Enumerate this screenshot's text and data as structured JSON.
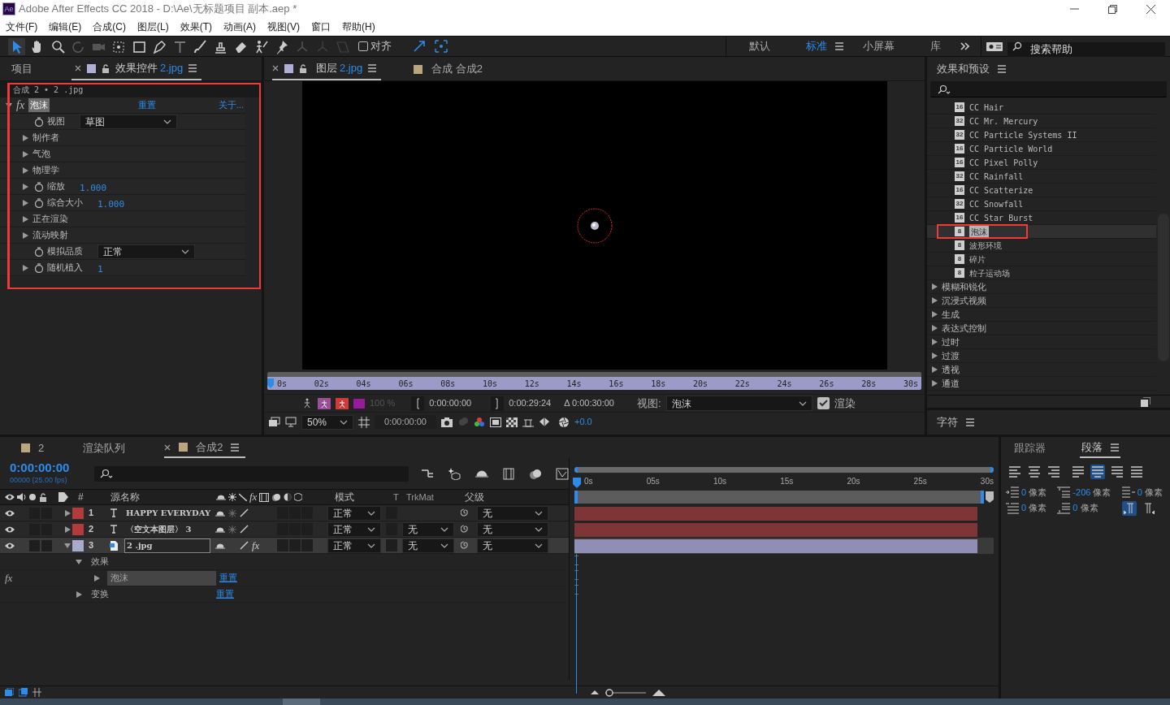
{
  "title_bar": {
    "app_icon": "Ae",
    "title": "Adobe After Effects CC 2018 - D:\\Ae\\无标题项目 副本.aep *"
  },
  "menu": [
    "文件(F)",
    "编辑(E)",
    "合成(C)",
    "图层(L)",
    "效果(T)",
    "动画(A)",
    "视图(V)",
    "窗口",
    "帮助(H)"
  ],
  "toolbar": {
    "snap": {
      "label": "对齐",
      "checked": false
    },
    "workspaces": [
      {
        "label": "默认",
        "selected": false
      },
      {
        "label": "标准",
        "selected": true
      },
      {
        "label": "小屏幕",
        "selected": false
      },
      {
        "label": "库",
        "selected": false
      }
    ],
    "search": {
      "placeholder": "搜索帮助"
    }
  },
  "effect_controls": {
    "tabs": [
      {
        "label": "项目",
        "selected": false
      },
      {
        "label": "效果控件",
        "suffix": "2.jpg",
        "selected": true
      }
    ],
    "breadcrumb": "合成 2 • 2 .jpg",
    "effect": {
      "fx": "fx",
      "name": "泡沫",
      "reset": "重置",
      "about": "关于..."
    },
    "properties": [
      {
        "label": "视图",
        "kind": "dropdown",
        "twirl": false,
        "stopwatch": true,
        "value": "草图"
      },
      {
        "label": "制作者",
        "kind": "group",
        "twirl": true,
        "stopwatch": false
      },
      {
        "label": "气泡",
        "kind": "group",
        "twirl": true,
        "stopwatch": false
      },
      {
        "label": "物理学",
        "kind": "group",
        "twirl": true,
        "stopwatch": false
      },
      {
        "label": "缩放",
        "kind": "value",
        "twirl": true,
        "stopwatch": true,
        "value": "1.000"
      },
      {
        "label": "综合大小",
        "kind": "value",
        "twirl": true,
        "stopwatch": true,
        "value": "1.000"
      },
      {
        "label": "正在渲染",
        "kind": "group",
        "twirl": true,
        "stopwatch": false
      },
      {
        "label": "流动映射",
        "kind": "group",
        "twirl": true,
        "stopwatch": false
      },
      {
        "label": "模拟品质",
        "kind": "dropdown",
        "twirl": false,
        "stopwatch": true,
        "value": "正常"
      },
      {
        "label": "随机植入",
        "kind": "value",
        "twirl": true,
        "stopwatch": true,
        "value": "1"
      }
    ]
  },
  "viewer": {
    "tabs": [
      {
        "label": "图层",
        "suffix": "2.jpg",
        "selected": true
      },
      {
        "label": "合成 合成2",
        "selected": false
      }
    ],
    "ruler": [
      "0s",
      "02s",
      "04s",
      "06s",
      "08s",
      "10s",
      "12s",
      "14s",
      "16s",
      "18s",
      "20s",
      "22s",
      "24s",
      "26s",
      "28s",
      "30s"
    ],
    "opacity": "100 %",
    "in_time": "0:00:00:00",
    "out_time": "0:00:29:24",
    "duration": "Δ 0:00:30:00",
    "view_label": "视图:",
    "view_value": "泡沫",
    "render": {
      "label": "渲染",
      "checked": true
    },
    "zoom": "50%",
    "current_time": "0:00:00:00",
    "exposure": "+0.0"
  },
  "effects_presets": {
    "title": "效果和预设",
    "items": [
      {
        "kind": "effect",
        "badge": "16",
        "label": "CC Hair",
        "selected": false
      },
      {
        "kind": "effect",
        "badge": "32",
        "label": "CC Mr. Mercury",
        "selected": false
      },
      {
        "kind": "effect",
        "badge": "32",
        "label": "CC Particle Systems II",
        "selected": false
      },
      {
        "kind": "effect",
        "badge": "16",
        "label": "CC Particle World",
        "selected": false
      },
      {
        "kind": "effect",
        "badge": "16",
        "label": "CC Pixel Polly",
        "selected": false
      },
      {
        "kind": "effect",
        "badge": "32",
        "label": "CC Rainfall",
        "selected": false
      },
      {
        "kind": "effect",
        "badge": "16",
        "label": "CC Scatterize",
        "selected": false
      },
      {
        "kind": "effect",
        "badge": "32",
        "label": "CC Snowfall",
        "selected": false
      },
      {
        "kind": "effect",
        "badge": "16",
        "label": "CC Star Burst",
        "selected": false
      },
      {
        "kind": "effect",
        "badge": "8",
        "label": "泡沫",
        "selected": true
      },
      {
        "kind": "effect",
        "badge": "8",
        "label": "波形环境",
        "selected": false
      },
      {
        "kind": "effect",
        "badge": "8",
        "label": "碎片",
        "selected": false
      },
      {
        "kind": "effect",
        "badge": "8",
        "label": "粒子运动场",
        "selected": false
      },
      {
        "kind": "category",
        "label": "模糊和锐化",
        "selected": false
      },
      {
        "kind": "category",
        "label": "沉浸式视频",
        "selected": false
      },
      {
        "kind": "category",
        "label": "生成",
        "selected": false
      },
      {
        "kind": "category",
        "label": "表达式控制",
        "selected": false
      },
      {
        "kind": "category",
        "label": "过时",
        "selected": false
      },
      {
        "kind": "category",
        "label": "过渡",
        "selected": false
      },
      {
        "kind": "category",
        "label": "透视",
        "selected": false
      },
      {
        "kind": "category",
        "label": "通道",
        "selected": false
      }
    ]
  },
  "character": {
    "title": "字符"
  },
  "timeline": {
    "tabs": [
      {
        "label": "2",
        "selected": false
      },
      {
        "label": "渲染队列",
        "selected": false
      },
      {
        "label": "合成2",
        "selected": true
      }
    ],
    "timecode": "0:00:00:00",
    "fps": "00000 (25.00 fps)",
    "columns": {
      "fx": "fx",
      "index": "#",
      "source": "源名称",
      "mode": "模式",
      "t": "T",
      "trkmat": "TrkMat",
      "parent": "父级"
    },
    "layers": [
      {
        "index": "1",
        "kind": "text",
        "name": "HAPPY EVERYDAY",
        "color": "#b33b3b",
        "mode": "正常",
        "parent": "无",
        "expanded": false,
        "selected": false
      },
      {
        "index": "2",
        "kind": "text",
        "name": "〈空文本图层〉 3",
        "color": "#b33b3b",
        "mode": "正常",
        "trkmat": "无",
        "parent": "无",
        "expanded": false,
        "selected": false
      },
      {
        "index": "3",
        "kind": "footage",
        "name": "2 .jpg",
        "color": "#a9a9cc",
        "mode": "正常",
        "trkmat": "无",
        "parent": "无",
        "expanded": true,
        "selected": true,
        "effect_switch": "fx"
      }
    ],
    "subrows": [
      {
        "label": "效果",
        "expanded": true,
        "children": [
          {
            "fx": "fx",
            "label": "泡沫",
            "link": "重置"
          }
        ]
      },
      {
        "label": "变换",
        "expanded": false,
        "link": "重置"
      }
    ],
    "ruler": [
      "0s",
      "05s",
      "10s",
      "15s",
      "20s",
      "25s",
      "30s"
    ]
  },
  "paragraph": {
    "tabs": [
      {
        "label": "跟踪器",
        "selected": false
      },
      {
        "label": "段落",
        "selected": true
      }
    ],
    "align": [
      {
        "selected": false
      },
      {
        "selected": false
      },
      {
        "selected": false
      },
      {
        "selected": false
      },
      {
        "selected": true
      },
      {
        "selected": false
      },
      {
        "selected": false
      }
    ],
    "indent_left": "0 像素",
    "space_before": "-206 像素",
    "indent_right": "0 像素",
    "indent_first": "0 像素",
    "space_after": "0 像素",
    "direction": [
      {
        "selected": true
      },
      {
        "selected": false
      }
    ]
  }
}
